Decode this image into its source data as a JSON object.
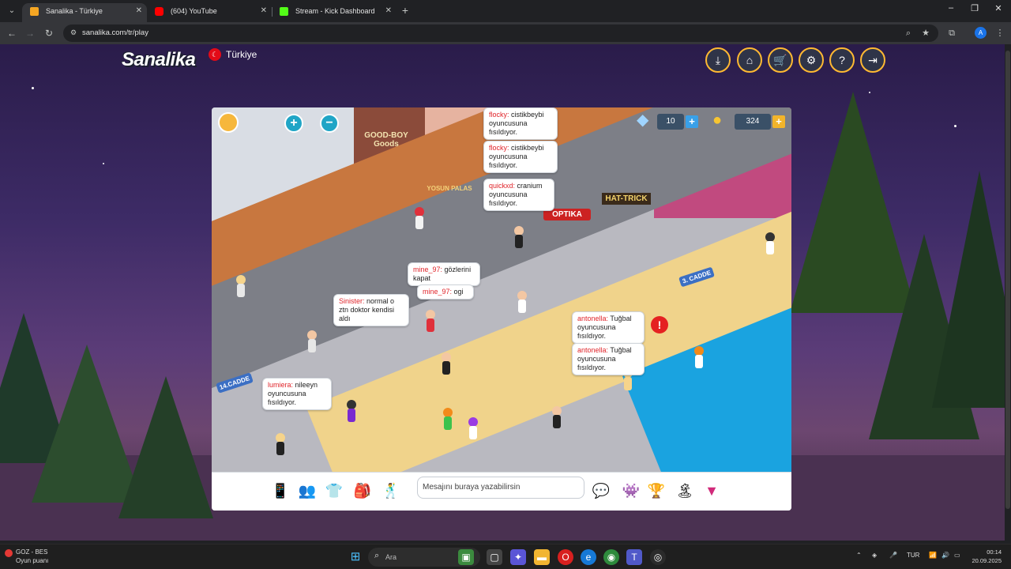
{
  "browser": {
    "tabs": [
      {
        "title": "Sanalika - Türkiye",
        "favicon_color": "#f5a623",
        "active": true
      },
      {
        "title": "(604) YouTube",
        "favicon_color": "#ff0000",
        "active": false
      },
      {
        "title": "Stream - Kick Dashboard",
        "favicon_color": "#53fc18",
        "active": false
      }
    ],
    "new_tab_label": "+",
    "url": "sanalika.com/tr/play",
    "profile_initial": "A"
  },
  "site_header": {
    "logo": "Sanalika",
    "region": "Türkiye",
    "buttons": [
      "download-icon",
      "home-icon",
      "cart-icon",
      "gear-icon",
      "help-icon",
      "logout-icon"
    ]
  },
  "game": {
    "diamonds": "10",
    "coins": "324",
    "street_signs": [
      "14.CADDE",
      "3. CADDE"
    ],
    "shop_signs": [
      "GOOD-BOY Goods",
      "YOSUN PALAS",
      "OPTIKA",
      "HAT-TRICK"
    ],
    "chats": [
      {
        "name": "flocky:",
        "text": "cistikbeybi oyuncusuna fısıldıyor."
      },
      {
        "name": "flocky:",
        "text": "cistikbeybi oyuncusuna fısıldıyor."
      },
      {
        "name": "quickxd:",
        "text": "cranium oyuncusuna fısıldıyor."
      },
      {
        "name": "mine_97:",
        "text": "gözlerini kapat"
      },
      {
        "name": "mine_97:",
        "text": "ogi"
      },
      {
        "name": "Sinister:",
        "text": "normal o ztn doktor kendisi aldı"
      },
      {
        "name": "antonella:",
        "text": "Tuğbal oyuncusuna fısıldıyor."
      },
      {
        "name": "antonella:",
        "text": "Tuğbal oyuncusuna fısıldıyor."
      },
      {
        "name": "lumiera:",
        "text": "nileeyn oyuncusuna fısıldıyor."
      }
    ],
    "message_placeholder": "Mesajını buraya yazabilirsin"
  },
  "taskbar": {
    "weather_line1": "GOZ - BES",
    "weather_line2": "Oyun puanı",
    "search_placeholder": "Ara",
    "lang": "TUR",
    "time": "00:14",
    "date": "20.09.2025"
  }
}
